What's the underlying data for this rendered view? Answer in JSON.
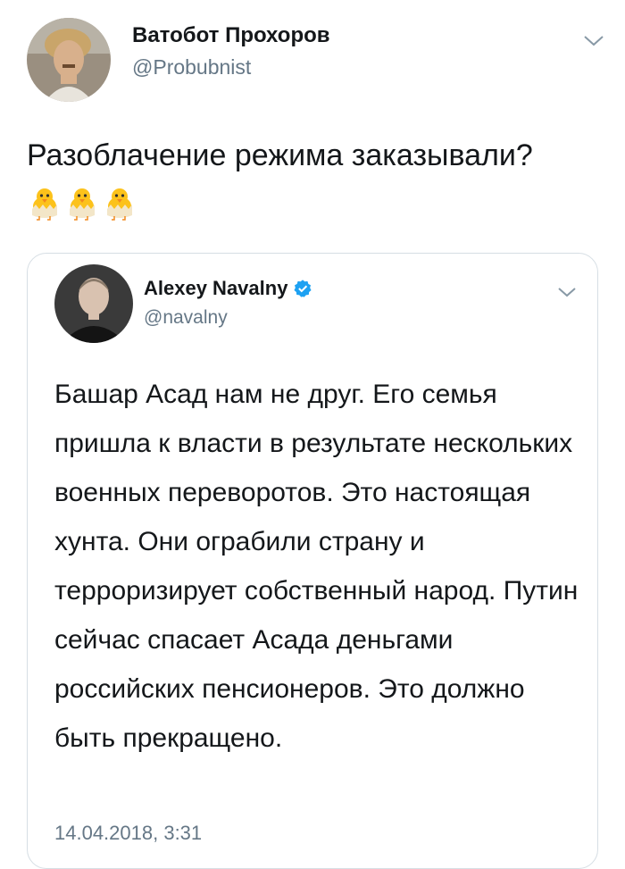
{
  "tweet": {
    "author_name": "Ватобот Прохоров",
    "author_handle": "@Probubnist",
    "text": "Разоблачение режима заказывали?",
    "emoji": [
      "hatching-chick",
      "hatching-chick",
      "hatching-chick"
    ]
  },
  "quoted_tweet": {
    "author_name": "Alexey Navalny",
    "author_handle": "@navalny",
    "verified": true,
    "text": "Башар Асад нам не друг. Его семья пришла к власти в результате нескольких военных переворотов. Это настоящая хунта. Они ограбили страну и терроризирует собственный народ. Путин сейчас спасает Асада деньгами российских пенсионеров. Это должно быть прекращено.",
    "date": "14.04.2018, 3:31"
  },
  "colors": {
    "text": "#14171a",
    "secondary": "#657786",
    "verified": "#1da1f2",
    "border": "#d6dee4"
  },
  "icons": {
    "menu": "chevron-down-icon",
    "verified": "verified-badge-icon"
  }
}
